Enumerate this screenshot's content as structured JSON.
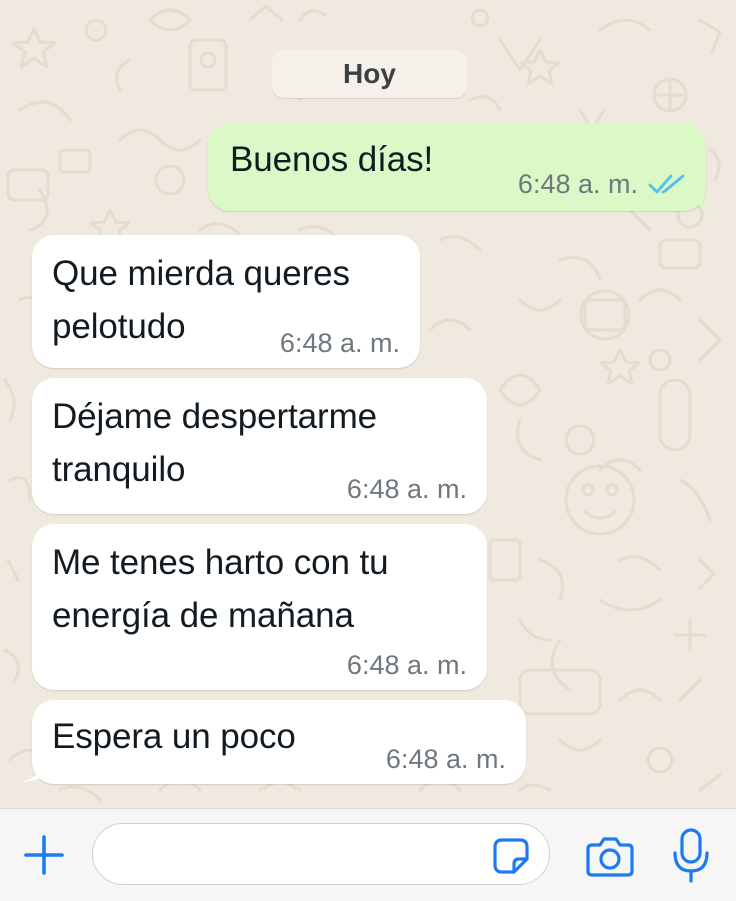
{
  "chat": {
    "date_separator": "Hoy",
    "messages": [
      {
        "direction": "outgoing",
        "text": "Buenos días!",
        "time": "6:48 a. m.",
        "status": "read"
      },
      {
        "direction": "incoming",
        "text": "Que mierda queres\npelotudo",
        "time": "6:48 a. m."
      },
      {
        "direction": "incoming",
        "text": "Déjame despertarme\ntranquilo",
        "time": "6:48 a. m."
      },
      {
        "direction": "incoming",
        "text": "Me tenes harto con tu\nenergía de mañana",
        "time": "6:48 a. m."
      },
      {
        "direction": "incoming",
        "text": "Espera un poco",
        "time": "6:48 a. m."
      }
    ]
  },
  "composer": {
    "value": "",
    "icons": {
      "attach": "plus-icon",
      "sticker": "sticker-icon",
      "camera": "camera-icon",
      "mic": "microphone-icon"
    }
  },
  "colors": {
    "wallpaper": "#efe9df",
    "outgoing_bubble": "#dbf8c7",
    "incoming_bubble": "#ffffff",
    "accent": "#1c7bf2",
    "read_ticks": "#53bdeb",
    "meta_text": "#6f787d"
  }
}
